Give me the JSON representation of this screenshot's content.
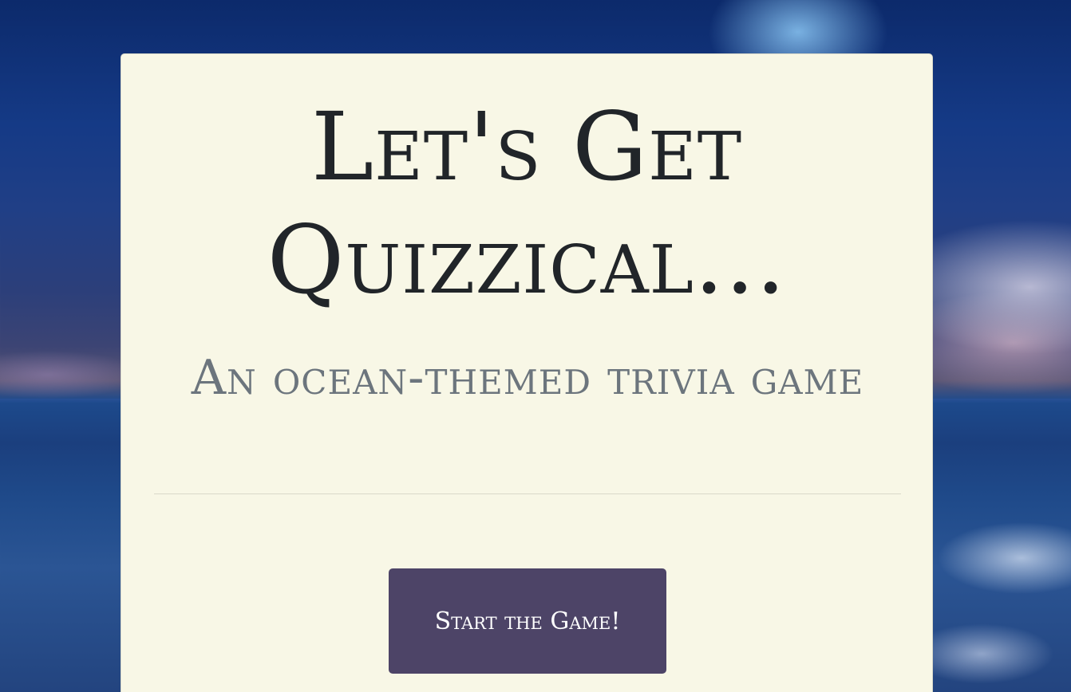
{
  "hero": {
    "title_line1": "Let's Get",
    "title_line2": "Quizzical...",
    "subtitle": "An ocean-themed trivia game"
  },
  "actions": {
    "start_label": "Start the Game!"
  },
  "colors": {
    "card_background": "#f8f7e6",
    "title_text": "#212529",
    "subtitle_text": "#6c757d",
    "button_background": "#4d4467",
    "button_text": "#ffffff"
  },
  "background": {
    "image": "ocean-beach-photo"
  }
}
